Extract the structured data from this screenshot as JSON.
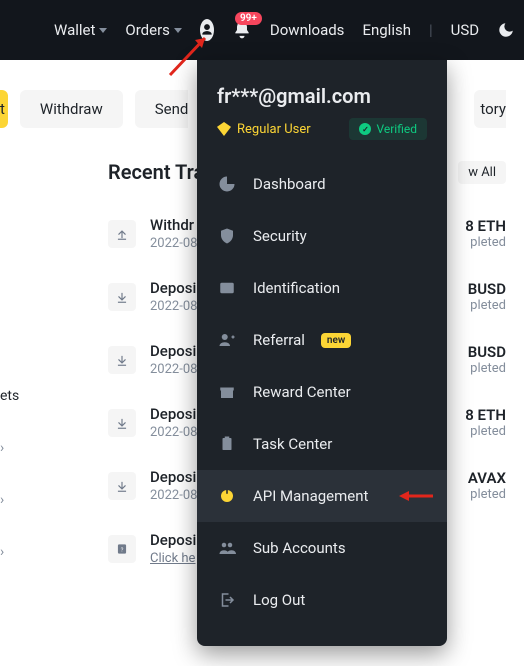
{
  "topbar": {
    "wallet": "Wallet",
    "orders": "Orders",
    "downloads": "Downloads",
    "language": "English",
    "currency": "USD",
    "badge": "99+"
  },
  "chips": {
    "c0": "t",
    "withdraw": "Withdraw",
    "send": "Send",
    "history": "tory"
  },
  "recent": {
    "title": "Recent Tran",
    "viewAll": "w All"
  },
  "left": {
    "ets": "ets"
  },
  "tx": [
    {
      "title": "Withdr",
      "date": "2022-08",
      "amt": "8 ETH",
      "status": "pleted",
      "icon": "up"
    },
    {
      "title": "Deposi",
      "date": "2022-08",
      "amt": "BUSD",
      "status": "pleted",
      "icon": "down"
    },
    {
      "title": "Deposi",
      "date": "2022-08",
      "amt": "BUSD",
      "status": "pleted",
      "icon": "down"
    },
    {
      "title": "Deposi",
      "date": "2022-08",
      "amt": "8 ETH",
      "status": "pleted",
      "icon": "down"
    },
    {
      "title": "Deposi",
      "date": "2022-08",
      "amt": "AVAX",
      "status": "pleted",
      "icon": "down"
    },
    {
      "title": "Deposi",
      "date": "Click he",
      "amt": "",
      "status": "",
      "icon": "q"
    }
  ],
  "dropdown": {
    "email": "fr***@gmail.com",
    "tier": "Regular User",
    "verified": "Verified",
    "items": {
      "dashboard": "Dashboard",
      "security": "Security",
      "identification": "Identification",
      "referral": "Referral",
      "referral_tag": "new",
      "reward": "Reward Center",
      "task": "Task Center",
      "api": "API Management",
      "sub": "Sub Accounts",
      "logout": "Log Out"
    }
  }
}
